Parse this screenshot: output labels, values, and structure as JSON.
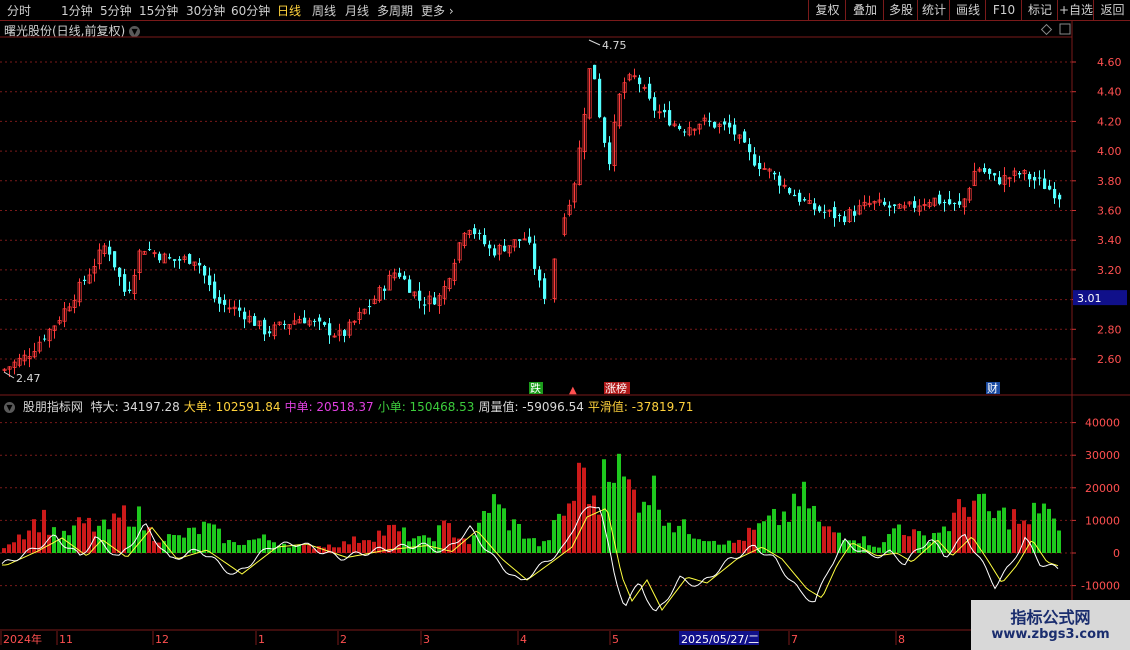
{
  "toolbar": {
    "periods": [
      {
        "label": "分时"
      },
      {
        "label": "1分钟"
      },
      {
        "label": "5分钟"
      },
      {
        "label": "15分钟"
      },
      {
        "label": "30分钟"
      },
      {
        "label": "60分钟"
      },
      {
        "label": "日线",
        "active": true
      },
      {
        "label": "周线"
      },
      {
        "label": "月线"
      },
      {
        "label": "多周期"
      },
      {
        "label": "更多"
      }
    ],
    "right_buttons": [
      "复权",
      "叠加",
      "多股",
      "统计",
      "画线",
      "F10",
      "标记",
      "+自选",
      "返回"
    ]
  },
  "stock": {
    "title": "曙光股份(日线,前复权)"
  },
  "price_chart": {
    "high_label": "4.75",
    "low_label": "2.47",
    "current_price": "3.01",
    "ticks": [
      "4.60",
      "4.40",
      "4.20",
      "4.00",
      "3.80",
      "3.60",
      "3.40",
      "3.20",
      "3.00",
      "2.80",
      "2.60"
    ],
    "markers": [
      "跌",
      "涨榜",
      "财"
    ]
  },
  "indicator": {
    "name": "股朋指标网",
    "items": [
      {
        "label": "特大: 34197.28",
        "color": "#d8d8d8"
      },
      {
        "label": "大单: 102591.84",
        "color": "#ffd23c"
      },
      {
        "label": "中单: 20518.37",
        "color": "#e040e0"
      },
      {
        "label": "小单: 150468.53",
        "color": "#3ccc3c"
      },
      {
        "label": "周量值: -59096.54",
        "color": "#d8d8d8"
      },
      {
        "label": "平滑值: -37819.71",
        "color": "#ffd23c"
      }
    ],
    "ticks": [
      "40000",
      "30000",
      "20000",
      "10000",
      "0",
      "-10000"
    ]
  },
  "xaxis": {
    "labels": [
      "2024年",
      "11",
      "12",
      "1",
      "2",
      "3",
      "4",
      "5",
      "7",
      "8"
    ],
    "cursor_date": "2025/05/27/二"
  },
  "watermark": {
    "line1": "指标公式网",
    "line2": "www.zbgs3.com"
  },
  "colors": {
    "up": "#ff3c3c",
    "down": "#54ffff",
    "bar_up": "#cc1a1a",
    "bar_down": "#1ec81e",
    "grid": "#7a1a1a",
    "line_white": "#ffffff",
    "line_yellow": "#ffff40"
  }
}
